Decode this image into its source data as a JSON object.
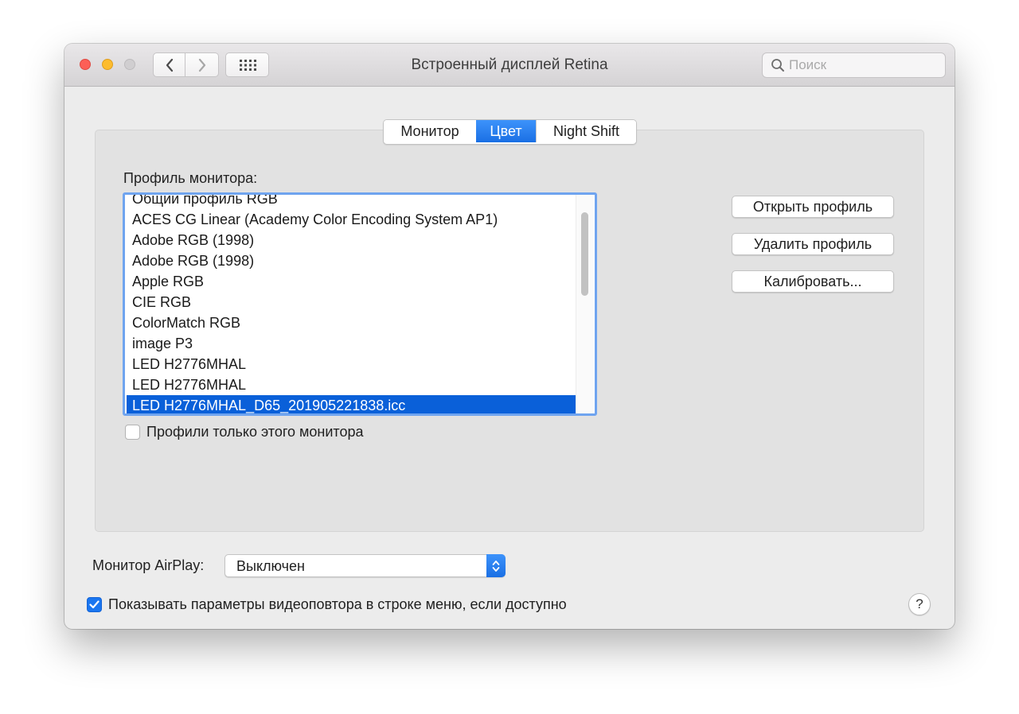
{
  "window": {
    "title": "Встроенный дисплей Retina",
    "search_placeholder": "Поиск"
  },
  "tabs": [
    {
      "label": "Монитор",
      "active": false
    },
    {
      "label": "Цвет",
      "active": true
    },
    {
      "label": "Night Shift",
      "active": false
    }
  ],
  "color": {
    "profile_label": "Профиль монитора:",
    "profiles": [
      "Общий профиль RGB",
      "ACES CG Linear (Academy Color Encoding System AP1)",
      "Adobe RGB (1998)",
      "Adobe RGB (1998)",
      "Apple RGB",
      "CIE RGB",
      "ColorMatch RGB",
      "image P3",
      "LED H2776MHAL",
      "LED H2776MHAL",
      "LED H2776MHAL_D65_201905221838.icc"
    ],
    "selected_profile": "LED H2776MHAL_D65_201905221838.icc",
    "buttons": {
      "open": "Открыть профиль",
      "delete": "Удалить профиль",
      "calibrate": "Калибровать..."
    },
    "only_this_monitor_label": "Профили только этого монитора",
    "only_this_monitor_checked": false
  },
  "airplay": {
    "label": "Монитор AirPlay:",
    "value": "Выключен"
  },
  "mirroring": {
    "label": "Показывать параметры видеоповтора в строке меню, если доступно",
    "checked": true
  },
  "help": "?",
  "colors": {
    "accent": "#1a6fe4",
    "selection": "#0a60d9",
    "close": "#fc5f57",
    "minimize": "#fdbc2e"
  }
}
